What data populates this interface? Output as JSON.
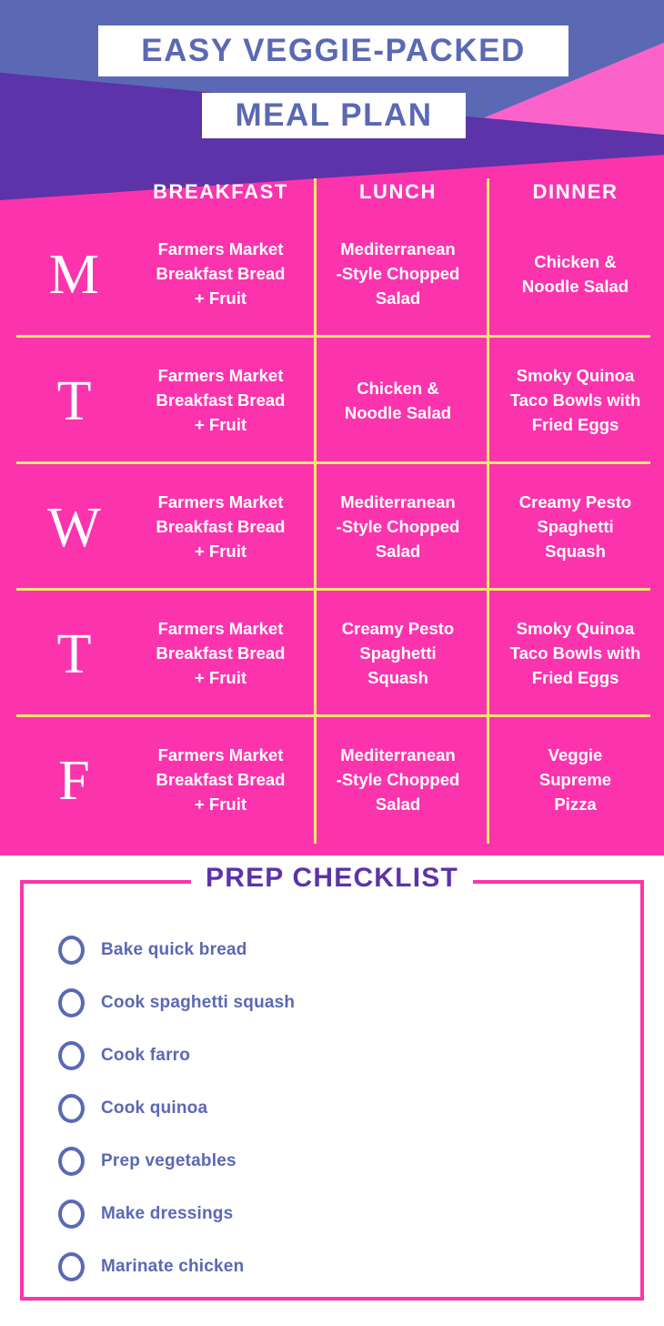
{
  "header": {
    "title_line1": "EASY VEGGIE-PACKED",
    "title_line2": "MEAL PLAN"
  },
  "colors": {
    "periwinkle": "#5b68b4",
    "dark_purple": "#5c33a8",
    "hot_pink": "#fb34ae",
    "light_pink": "#fb63ca",
    "yellow_divider": "#f5e96b",
    "white": "#ffffff"
  },
  "meal_table": {
    "columns": [
      "BREAKFAST",
      "LUNCH",
      "DINNER"
    ],
    "rows": [
      {
        "day": "M",
        "breakfast": [
          "Farmers Market",
          "Breakfast Bread",
          "+ Fruit"
        ],
        "lunch": [
          "Mediterranean",
          "-Style Chopped",
          "Salad"
        ],
        "dinner": [
          "Chicken &",
          "Noodle Salad"
        ]
      },
      {
        "day": "T",
        "breakfast": [
          "Farmers Market",
          "Breakfast Bread",
          "+ Fruit"
        ],
        "lunch": [
          "Chicken &",
          "Noodle Salad"
        ],
        "dinner": [
          "Smoky Quinoa",
          "Taco Bowls with",
          "Fried Eggs"
        ]
      },
      {
        "day": "W",
        "breakfast": [
          "Farmers Market",
          "Breakfast Bread",
          "+ Fruit"
        ],
        "lunch": [
          "Mediterranean",
          "-Style Chopped",
          "Salad"
        ],
        "dinner": [
          "Creamy Pesto",
          "Spaghetti",
          "Squash"
        ]
      },
      {
        "day": "T",
        "breakfast": [
          "Farmers Market",
          "Breakfast Bread",
          "+ Fruit"
        ],
        "lunch": [
          "Creamy Pesto",
          "Spaghetti",
          "Squash"
        ],
        "dinner": [
          "Smoky Quinoa",
          "Taco Bowls with",
          "Fried Eggs"
        ]
      },
      {
        "day": "F",
        "breakfast": [
          "Farmers Market",
          "Breakfast Bread",
          "+ Fruit"
        ],
        "lunch": [
          "Mediterranean",
          "-Style Chopped",
          "Salad"
        ],
        "dinner": [
          "Veggie",
          "Supreme",
          "Pizza"
        ]
      }
    ]
  },
  "checklist": {
    "title": "PREP CHECKLIST",
    "items": [
      "Bake quick bread",
      "Cook spaghetti squash",
      "Cook farro",
      "Cook quinoa",
      "Prep vegetables",
      "Make dressings",
      "Marinate chicken"
    ]
  }
}
